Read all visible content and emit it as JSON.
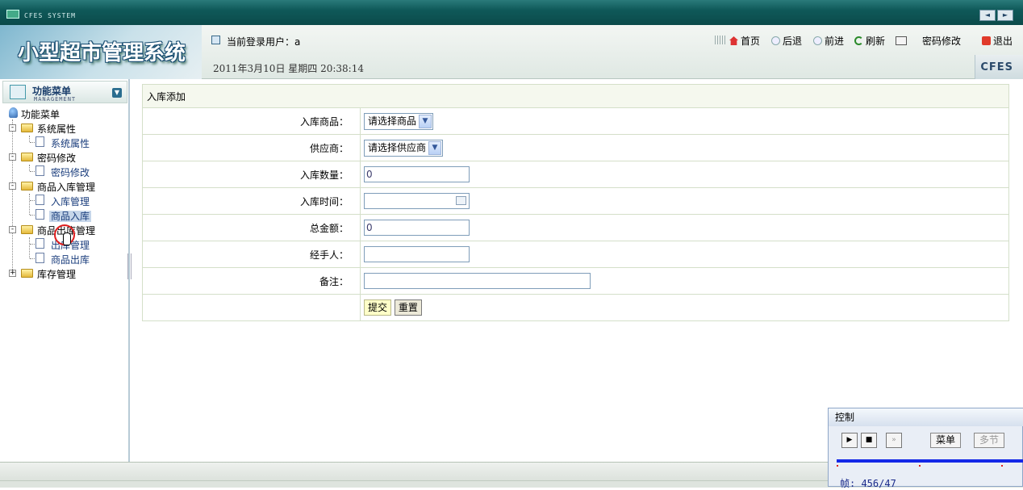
{
  "window": {
    "title": "CFES SYSTEM",
    "btn_prev": "◄",
    "btn_next": "►"
  },
  "header": {
    "system_title": "小型超市管理系统",
    "current_user": "当前登录用户：a",
    "datetime": "2011年3月10日  星期四  20:38:14",
    "brand": "CFES",
    "links": {
      "home": "首页",
      "back": "后退",
      "forward": "前进",
      "refresh": "刷新",
      "password": "密码修改",
      "logout": "退出"
    }
  },
  "sidebar": {
    "title": "功能菜单",
    "subtitle": "MANAGEMENT",
    "root": "功能菜单",
    "groups": [
      {
        "label": "系统属性",
        "expand": "-",
        "children": [
          "系统属性"
        ]
      },
      {
        "label": "密码修改",
        "expand": "-",
        "children": [
          "密码修改"
        ]
      },
      {
        "label": "商品入库管理",
        "expand": "-",
        "children": [
          "入库管理",
          "商品入库"
        ]
      },
      {
        "label": "商品出库管理",
        "expand": "-",
        "children": [
          "出库管理",
          "商品出库"
        ]
      },
      {
        "label": "库存管理",
        "expand": "+",
        "children": []
      }
    ],
    "selected": "商品入库"
  },
  "form": {
    "caption": "入库添加",
    "product": {
      "label": "入库商品：",
      "value": "请选择商品"
    },
    "supplier": {
      "label": "供应商：",
      "value": "请选择供应商"
    },
    "quantity": {
      "label": "入库数量：",
      "value": "0"
    },
    "time": {
      "label": "入库时间：",
      "value": ""
    },
    "total": {
      "label": "总金额：",
      "value": "0"
    },
    "handler": {
      "label": "经手人：",
      "value": ""
    },
    "remark": {
      "label": "备注：",
      "value": ""
    },
    "submit": "提交",
    "reset": "重置"
  },
  "control": {
    "title": "控制",
    "menu": "菜单",
    "multi": "多节",
    "frame": "帧: 456/47"
  },
  "colors": {
    "header_teal": "#0f5959",
    "title_blue": "#1a4e73",
    "form_border": "#d4dfc9",
    "track_blue": "#1428e8"
  }
}
